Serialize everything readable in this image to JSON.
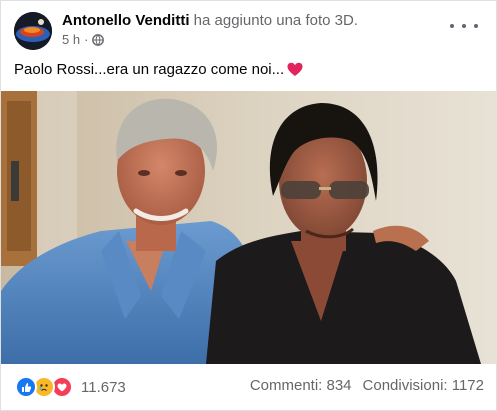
{
  "post": {
    "author": "Antonello Venditti",
    "action": "ha aggiunto una foto 3D.",
    "time": "5 h",
    "caption": "Paolo Rossi...era un ragazzo come noi...",
    "photo_alt": "Foto 3D"
  },
  "reactions": {
    "types": [
      "like-icon",
      "sad-icon",
      "love-icon"
    ],
    "count": "11.673"
  },
  "stats": {
    "comments": "Commenti: 834",
    "shares": "Condivisioni: 1172"
  },
  "colors": {
    "like": "#1877f2",
    "sad": "#f7b928",
    "love": "#f33e58",
    "meta_text": "#65676b"
  }
}
